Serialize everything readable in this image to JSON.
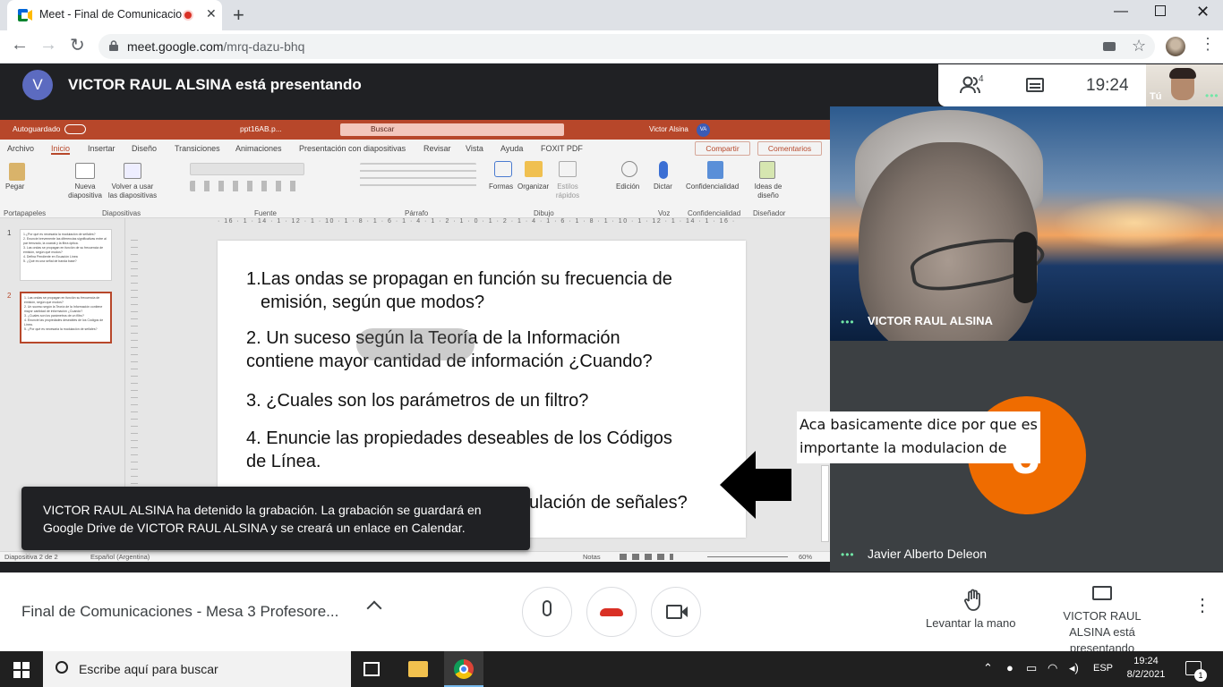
{
  "browser": {
    "tab_title": "Meet - Final de Comunicacio",
    "tab_close": "✕",
    "new_tab": "+",
    "url_host": "meet.google.com",
    "url_path": "/mrq-dazu-bhq",
    "window_min": "—",
    "window_close": "✕",
    "back": "←",
    "forward": "→",
    "reload": "↻",
    "star": "☆",
    "menu": "⋮"
  },
  "meet": {
    "presenter_initial": "V",
    "presenter_banner": "VICTOR RAUL ALSINA está presentando",
    "people_count": "4",
    "clock": "19:24",
    "self_label": "Tú",
    "dots": "•••",
    "participants": [
      {
        "name": "VICTOR RAUL ALSINA"
      },
      {
        "name": "Javier Alberto Deleon",
        "initial": "J"
      }
    ],
    "snackbar": "VICTOR RAUL ALSINA ha detenido la grabación. La grabación se guardará en Google Drive de VICTOR RAUL ALSINA y se creará un enlace en Calendar.",
    "meeting_title": "Final de Comunicaciones - Mesa 3 Profesore...",
    "raise_hand": "Levantar la mano",
    "presenting_label": "VICTOR RAUL ALSINA está presentando",
    "more": "⋮",
    "annotation": "Aca basicamente dice por que es importante la modulacion de señales"
  },
  "powerpoint": {
    "autosave": "Autoguardado",
    "filename": "ppt16AB.p...",
    "search": "Buscar",
    "user": "Victor Alsina",
    "user_initials": "VA",
    "menu": [
      "Archivo",
      "Inicio",
      "Insertar",
      "Diseño",
      "Transiciones",
      "Animaciones",
      "Presentación con diapositivas",
      "Revisar",
      "Vista",
      "Ayuda",
      "FOXIT PDF"
    ],
    "share": "Compartir",
    "comments": "Comentarios",
    "ribbon_buttons": {
      "paste": "Pegar",
      "new_slide": "Nueva diapositiva",
      "reuse": "Volver a usar las diapositivas",
      "shapes": "Formas",
      "arrange": "Organizar",
      "styles": "Estilos rápidos",
      "edit": "Edición",
      "dictate": "Dictar",
      "confidential": "Confidencialidad",
      "designer": "Ideas de diseño"
    },
    "ribbon_groups": [
      "Portapapeles",
      "Diapositivas",
      "Fuente",
      "Párrafo",
      "Dibujo",
      "Voz",
      "Confidencialidad",
      "Diseñador"
    ],
    "ruler": "· 16 · 1 · 14 · 1 · 12 · 1 · 10 · 1 · 8 · 1 · 6 · 1 · 4 · 1 · 2 · 1 · 0 · 1 · 2 · 1 · 4 · 1 · 6 · 1 · 8 · 1 · 10 · 1 · 12 · 1 · 14 · 1 · 16 ·",
    "thumbnails": [
      {
        "num": "1",
        "lines": [
          "1.¿Por qué es necesaria la modulación de señales?",
          "2. Enuncie brevemente las diferencias significativas entre al par trenzado, la coaxial y la fibra óptica.",
          "3. Las ondas se propagan en función de su frecuencia de emisión, según qué modos?",
          "4. Defina Pendiente en Ecuación Línea",
          "5. ¿Qué es una señal de banda base?"
        ]
      },
      {
        "num": "2",
        "lines": [
          "1. Las ondas se propagan en función su frecuencia de emisión, según que modos?",
          "2. Un suceso según la Teoría de la Información contiene mayor cantidad de información ¿Cuando?",
          "3. ¿Cuales son los parámetros de un filtro?",
          "4. Enuncie las propiedades deseables de los Códigos de Línea.",
          "5. ¿Por qué es necesaria la modulación de señales?"
        ]
      }
    ],
    "slide_lines": [
      "1.Las ondas se propagan en función su frecuencia de",
      "emisión, según que modos?",
      "2. Un suceso según la Teoría de la Información",
      "contiene mayor cantidad de información ¿Cuando?",
      "3. ¿Cuales son los parámetros de un filtro?",
      "4. Enuncie las propiedades deseables de los Códigos",
      "de Línea.",
      "ulación de señales?"
    ],
    "status": {
      "slide_counter": "Diapositiva 2 de 2",
      "language": "Español (Argentina)",
      "notes": "Notas",
      "zoom": "60%"
    }
  },
  "taskbar": {
    "search_placeholder": "Escribe aquí para buscar",
    "language": "ESP",
    "time": "19:24",
    "date": "8/2/2021",
    "notifications": "1"
  },
  "colors": {
    "powerpoint_accent": "#b7472a",
    "meet_orange": "#ef6c00",
    "recording_red": "#d93025"
  }
}
